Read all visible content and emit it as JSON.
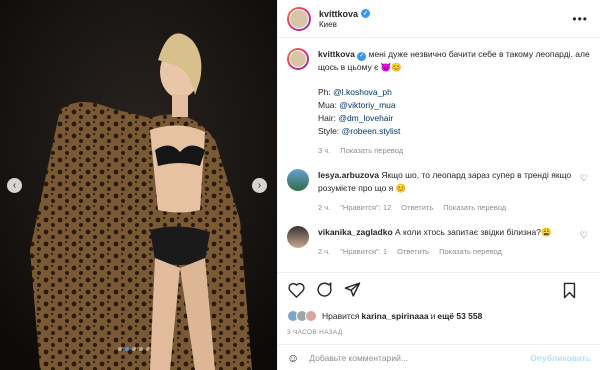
{
  "header": {
    "username": "kvittkova",
    "location": "Киев",
    "more_icon": "more-horizontal-icon"
  },
  "caption": {
    "username": "kvittkova",
    "text": "мені дуже незвично бачити себе в такому леопарді. але щось в цьому є 😈😊",
    "credits": [
      {
        "label": "Ph: ",
        "handle": "@l.koshova_ph"
      },
      {
        "label": "Mua: ",
        "handle": "@viktoriy_mua"
      },
      {
        "label": "Hair: ",
        "handle": "@dm_lovehair"
      },
      {
        "label": "Style: ",
        "handle": "@robeen.stylist"
      }
    ],
    "time": "3 ч.",
    "translate": "Показать перевод"
  },
  "comments": [
    {
      "username": "lesya.arbuzova",
      "text": "Якщо шо, то леопард зараз супер в тренді якщо розумієте про що я 😊",
      "time": "2 ч.",
      "likes": "\"Нравится\": 12",
      "reply": "Ответить",
      "translate": "Показать перевод"
    },
    {
      "username": "vikanika_zagladko",
      "text": "А коли хтось запитає звідки білизна?😩",
      "time": "2 ч.",
      "likes": "\"Нравится\": 1",
      "reply": "Ответить",
      "translate": "Показать перевод"
    }
  ],
  "likes": {
    "prefix": "Нравится ",
    "user": "karina_spirinaaa",
    "middle": " и ",
    "count": "ещё 53 558"
  },
  "timestamp": "3 ЧАСОВ НАЗАД",
  "add_comment": {
    "placeholder": "Добавьте комментарий...",
    "publish": "Опубликовать"
  },
  "carousel": {
    "slide_count": 5,
    "active_index": 1
  },
  "colors": {
    "accent": "#3897f0",
    "publish_disabled": "#b2dffc",
    "link": "#00376b",
    "muted": "#8e8e8e"
  }
}
